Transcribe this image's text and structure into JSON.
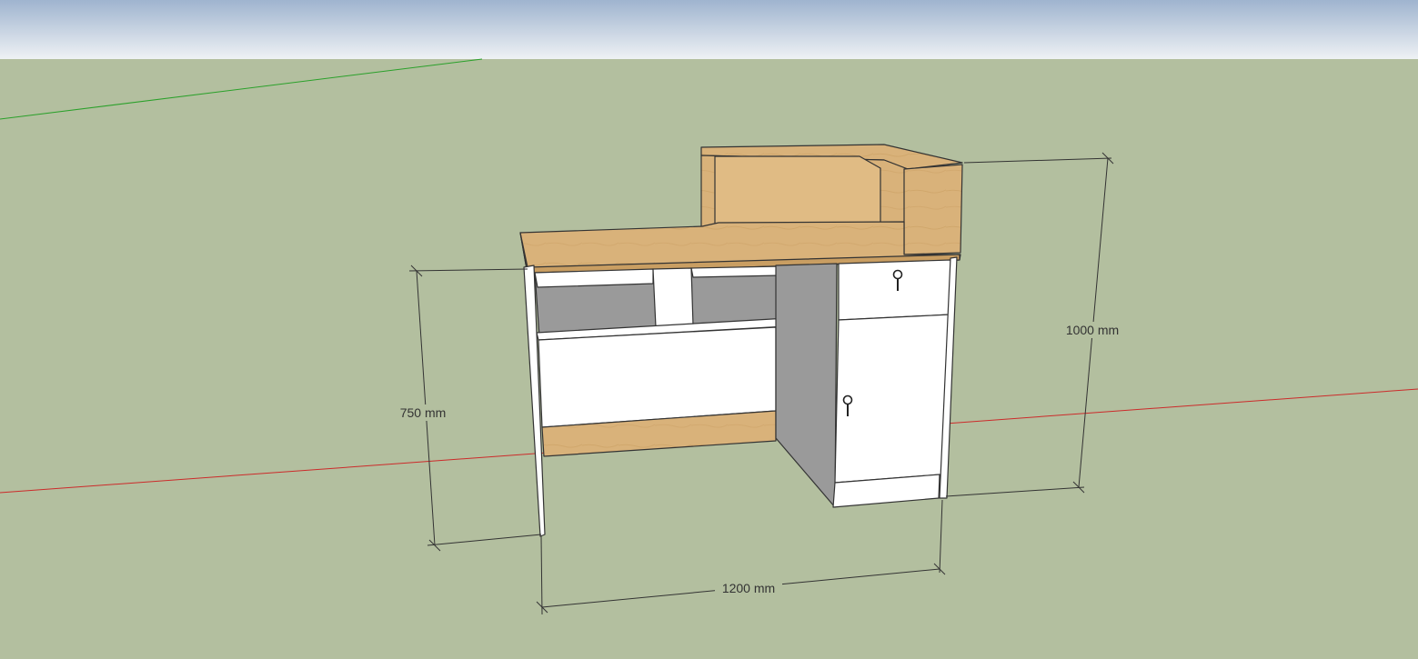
{
  "scene": {
    "sky_color_top": "#9fb4cf",
    "sky_color_bottom": "#eef1f4",
    "ground_color": "#b3bf9f",
    "axis_colors": {
      "red": "#cc2a2a",
      "green": "#2aa02a"
    }
  },
  "model": {
    "wood_color": "#d9b27a",
    "panel_color": "#ffffff",
    "shadow_color": "#9a9a9a",
    "edge_color": "#333333",
    "icons": [
      "lock-icon",
      "lock-icon"
    ]
  },
  "dimensions": {
    "width": "1200 mm",
    "desk_height": "750 mm",
    "total_height": "1000 mm"
  }
}
